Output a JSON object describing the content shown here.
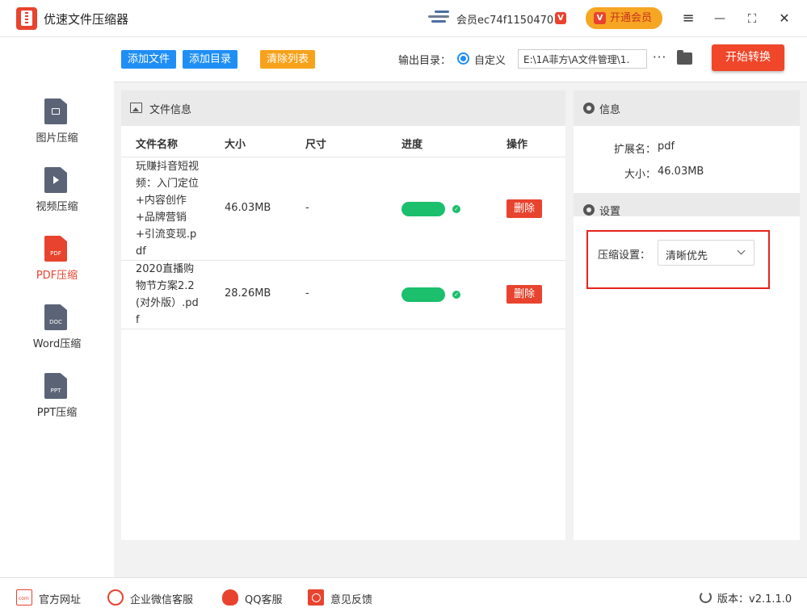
{
  "app": {
    "title": "优速文件压缩器"
  },
  "user": {
    "name": "会员ec74f1150470",
    "vip_mark": "V",
    "vip_button": "开通会员"
  },
  "window": {
    "menu": "≡",
    "minimize": "—",
    "maximize": "⛶",
    "close": "✕"
  },
  "sidebar": {
    "items": [
      {
        "label": "图片压缩",
        "icon": "image-file-icon",
        "tag": ""
      },
      {
        "label": "视频压缩",
        "icon": "video-file-icon",
        "tag": ""
      },
      {
        "label": "PDF压缩",
        "icon": "pdf-file-icon",
        "tag": "PDF",
        "active": true
      },
      {
        "label": "Word压缩",
        "icon": "word-file-icon",
        "tag": "DOC"
      },
      {
        "label": "PPT压缩",
        "icon": "ppt-file-icon",
        "tag": "PPT"
      }
    ]
  },
  "toolbar": {
    "add_file": "添加文件",
    "add_folder": "添加目录",
    "clear_list": "清除列表",
    "output_label": "输出目录：",
    "output_option": "自定义",
    "output_path": "E:\\1A菲方\\A文件管理\\1.",
    "more": "···",
    "start": "开始转换"
  },
  "file_panel": {
    "title": "文件信息",
    "columns": {
      "name": "文件名称",
      "size": "大小",
      "dims": "尺寸",
      "progress": "进度",
      "action": "操作"
    },
    "rows": [
      {
        "name": "玩赚抖音短视频：入门定位+内容创作+品牌营销+引流变现.pdf",
        "size": "46.03MB",
        "dims": "-",
        "progress": 1.0,
        "action": "删除"
      },
      {
        "name": "2020直播购物节方案2.2(对外版）.pdf",
        "size": "28.26MB",
        "dims": "-",
        "progress": 1.0,
        "action": "删除"
      }
    ]
  },
  "info_panel": {
    "title": "信息",
    "ext_label": "扩展名：",
    "ext_value": "pdf",
    "size_label": "大小：",
    "size_value": "46.03MB",
    "settings_title": "设置",
    "compress_label": "压缩设置：",
    "compress_value": "清晰优先"
  },
  "footer": {
    "website": "官方网址",
    "wechat": "企业微信客服",
    "qq": "QQ客服",
    "feedback": "意见反馈",
    "version": "版本：v2.1.1.0"
  },
  "colors": {
    "accent": "#e8432e",
    "blue": "#1f8ff5",
    "orange": "#f7a21c",
    "green": "#1cbf6b",
    "highlight": "#e8231c"
  }
}
